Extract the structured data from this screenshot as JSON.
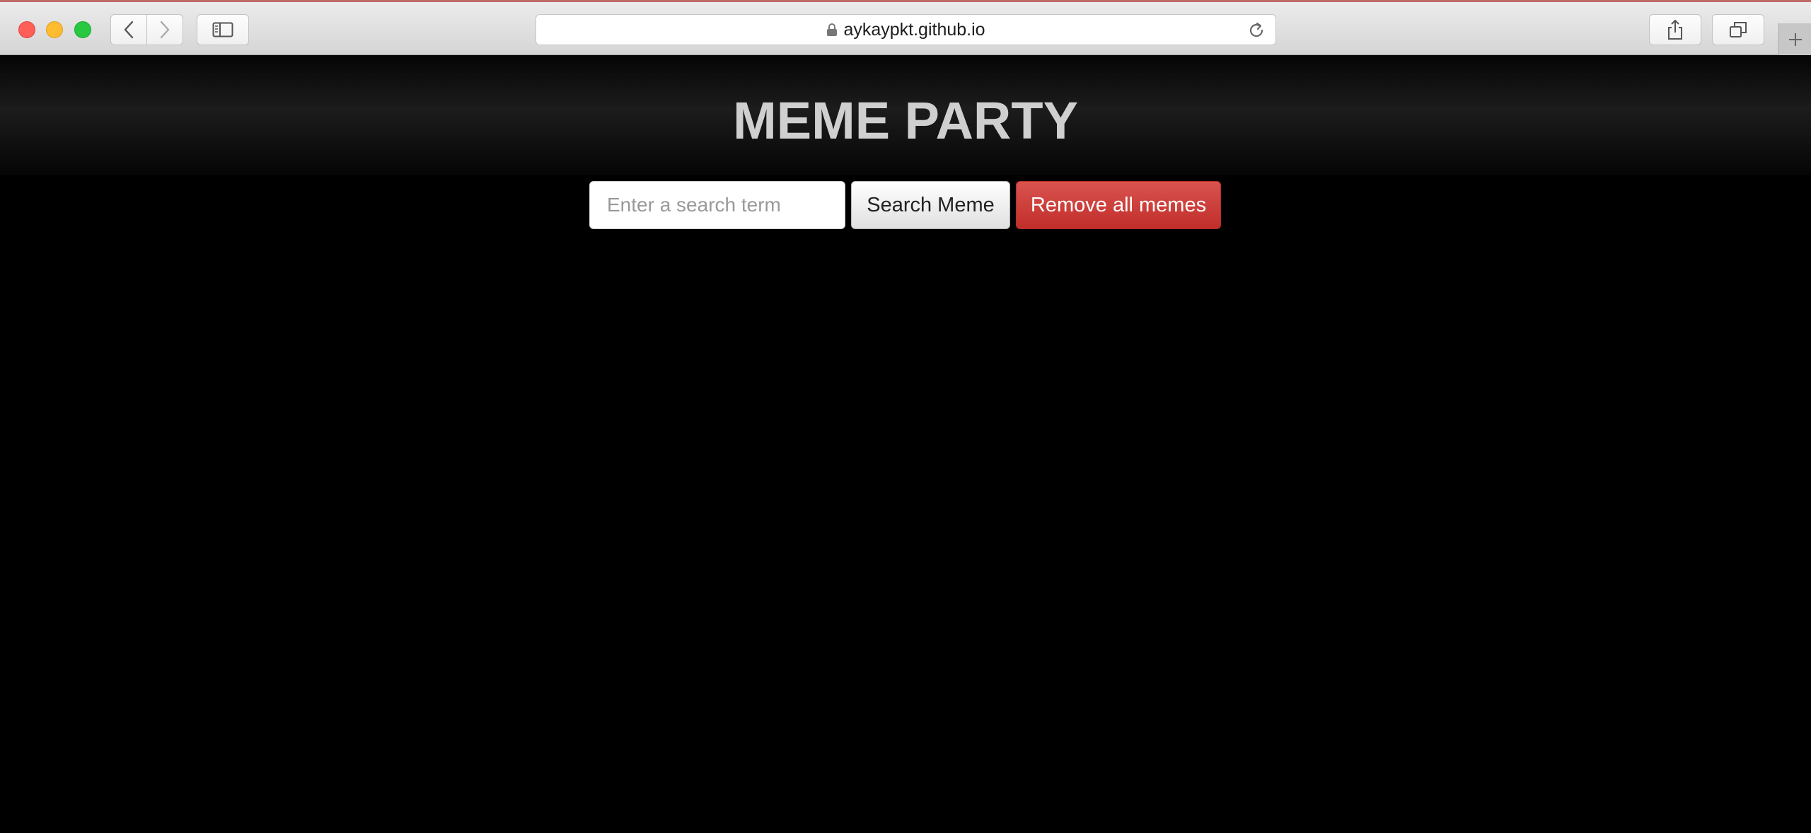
{
  "browser": {
    "url": "aykaypkt.github.io",
    "icons": {
      "back": "chevron-left-icon",
      "forward": "chevron-right-icon",
      "sidebar": "sidebar-icon",
      "lock": "lock-icon",
      "reload": "reload-icon",
      "share": "share-icon",
      "tabs": "tabs-overview-icon",
      "new_tab": "plus-icon"
    }
  },
  "page": {
    "title": "MEME PARTY",
    "search": {
      "placeholder": "Enter a search term",
      "value": ""
    },
    "search_button_label": "Search Meme",
    "remove_button_label": "Remove all memes"
  },
  "colors": {
    "background": "#000000",
    "title": "#cfcfcf",
    "danger_button": "#d9534f"
  }
}
